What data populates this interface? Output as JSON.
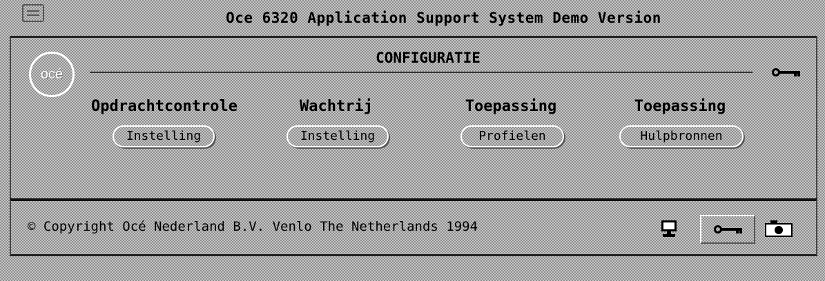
{
  "window": {
    "title": "Oce 6320 Application Support System Demo Version"
  },
  "panel": {
    "logo_text": "océ",
    "section_title": "CONFIGURATIE",
    "columns": [
      {
        "header": "Opdrachtcontrole",
        "button": "Instelling"
      },
      {
        "header": "Wachtrij",
        "button": "Instelling"
      },
      {
        "header": "Toepassing",
        "button": "Profielen"
      },
      {
        "header": "Toepassing",
        "button": "Hulpbronnen"
      }
    ]
  },
  "footer": {
    "copyright": "© Copyright Océ Nederland B.V. Venlo The Netherlands 1994"
  },
  "icons": {
    "window_menu": "window-menu-icon",
    "key": "key-icon",
    "monitor": "monitor-icon",
    "camera": "camera-icon"
  }
}
